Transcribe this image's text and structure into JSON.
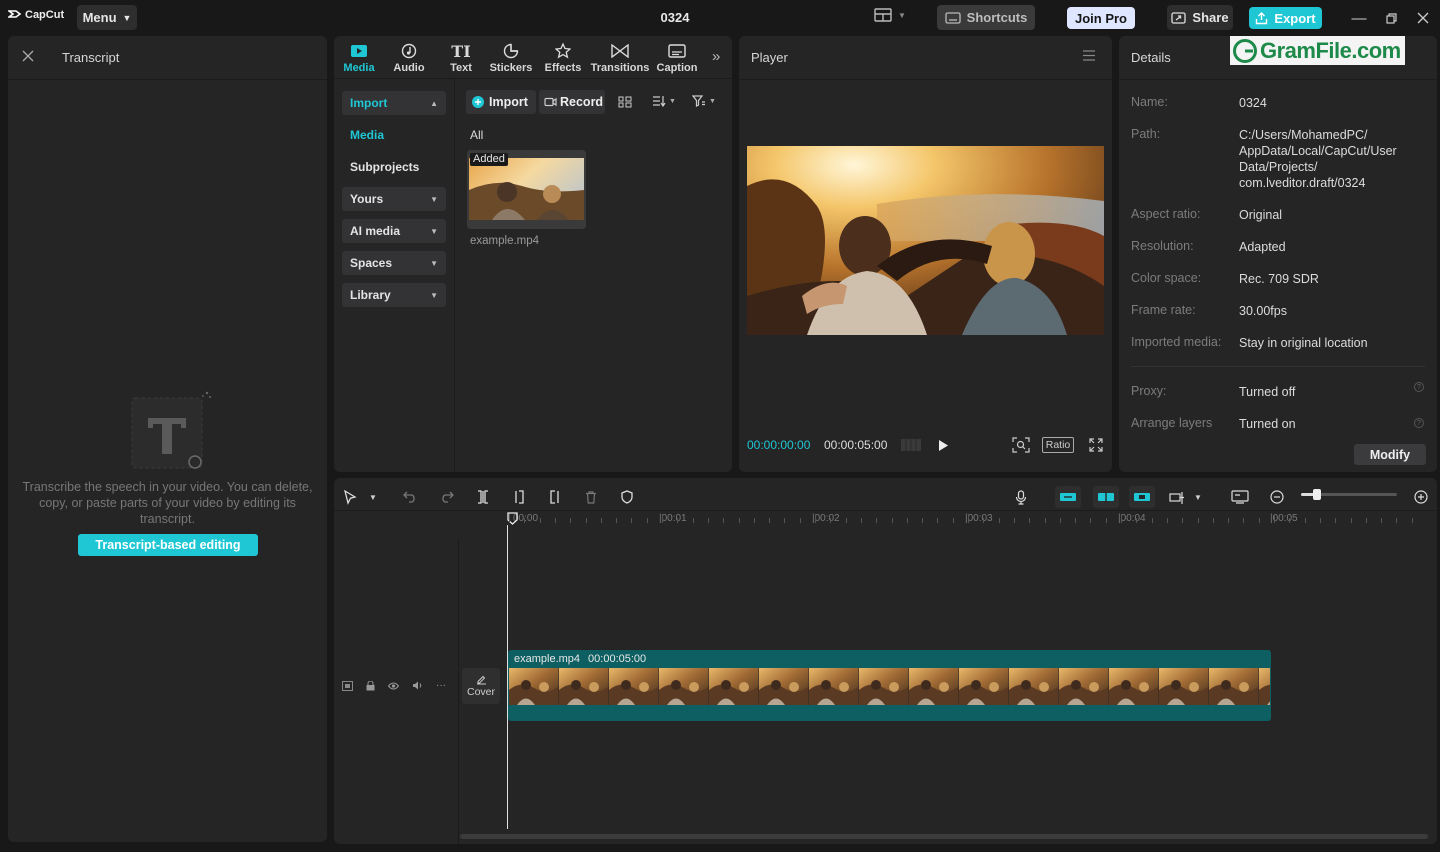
{
  "app": {
    "logo": "CapCut",
    "menu_label": "Menu",
    "project_title": "0324",
    "shortcuts_label": "Shortcuts",
    "joinpro_label": "Join Pro",
    "share_label": "Share",
    "export_label": "Export",
    "accent": "#1fc7d4",
    "watermark": "GramFile.com"
  },
  "transcript": {
    "title": "Transcript",
    "description": "Transcribe the speech in your video. You can delete, copy, or paste parts of your video by editing its transcript.",
    "button_label": "Transcript-based editing"
  },
  "media": {
    "tools": [
      {
        "label": "Media",
        "icon": "media-icon"
      },
      {
        "label": "Audio",
        "icon": "audio-icon"
      },
      {
        "label": "Text",
        "icon": "text-icon"
      },
      {
        "label": "Stickers",
        "icon": "stickers-icon"
      },
      {
        "label": "Effects",
        "icon": "effects-icon"
      },
      {
        "label": "Transitions",
        "icon": "transitions-icon"
      },
      {
        "label": "Caption",
        "icon": "caption-icon"
      }
    ],
    "sidebar": [
      {
        "label": "Import"
      },
      {
        "label": "Media"
      },
      {
        "label": "Subprojects"
      },
      {
        "label": "Yours"
      },
      {
        "label": "AI media"
      },
      {
        "label": "Spaces"
      },
      {
        "label": "Library"
      }
    ],
    "import_label": "Import",
    "record_label": "Record",
    "filter_label": "All",
    "clip": {
      "badge": "Added",
      "name": "example.mp4"
    }
  },
  "player": {
    "title": "Player",
    "current_time": "00:00:00:00",
    "total_time": "00:00:05:00",
    "ratio_label": "Ratio"
  },
  "details": {
    "title": "Details",
    "rows": [
      {
        "key": "Name:",
        "value": "0324"
      },
      {
        "key": "Path:",
        "value": "C:/Users/MohamedPC/ AppData/Local/CapCut/User Data/Projects/ com.lveditor.draft/0324"
      },
      {
        "key": "Aspect ratio:",
        "value": "Original"
      },
      {
        "key": "Resolution:",
        "value": "Adapted"
      },
      {
        "key": "Color space:",
        "value": "Rec. 709 SDR"
      },
      {
        "key": "Frame rate:",
        "value": "30.00fps"
      },
      {
        "key": "Imported media:",
        "value": "Stay in original location"
      },
      {
        "key": "Proxy:",
        "value": "Turned off"
      },
      {
        "key": "Arrange layers",
        "value": "Turned on"
      }
    ],
    "modify_label": "Modify"
  },
  "timeline": {
    "ruler": [
      "00:00",
      "|00:01",
      "|00:02",
      "|00:03",
      "|00:04",
      "|00:05"
    ],
    "cover_label": "Cover",
    "clip_name": "example.mp4",
    "clip_duration": "00:00:05:00",
    "zoom_level": 0.17
  }
}
